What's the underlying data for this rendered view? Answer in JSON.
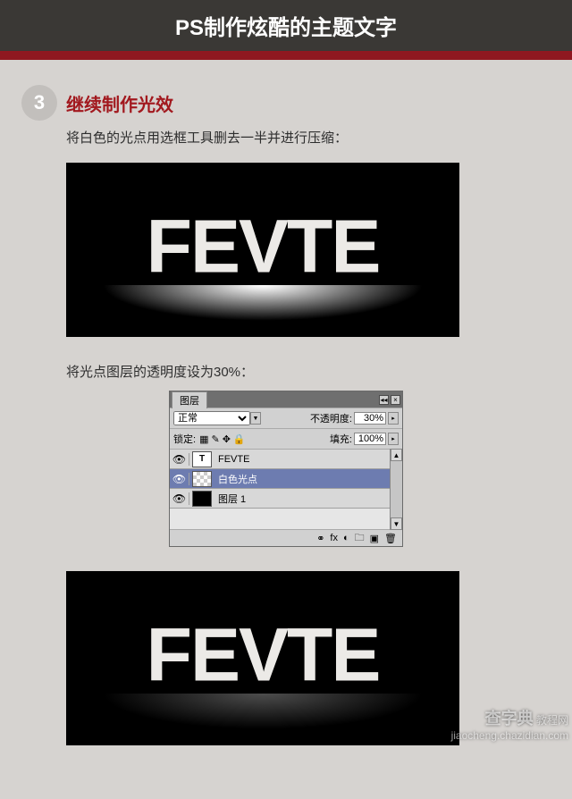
{
  "header": {
    "title": "PS制作炫酷的主题文字"
  },
  "step": {
    "number": "3",
    "title": "继续制作光效",
    "desc1": "将白色的光点用选框工具删去一半并进行压缩：",
    "desc2": "将光点图层的透明度设为30%："
  },
  "showcase": {
    "text": "FEVTE"
  },
  "panel": {
    "tab": "图层",
    "blend_label": "正常",
    "opacity_label": "不透明度:",
    "opacity_value": "30%",
    "lock_label": "锁定:",
    "fill_label": "填充:",
    "fill_value": "100%",
    "layers": [
      {
        "name": "FEVTE",
        "thumb": "text",
        "selected": false
      },
      {
        "name": "白色光点",
        "thumb": "trans",
        "selected": true
      },
      {
        "name": "图层 1",
        "thumb": "black",
        "selected": false
      }
    ]
  },
  "watermark": {
    "main": "查字典",
    "sub": "教程网",
    "url": "jiaocheng.chazidian.com"
  }
}
